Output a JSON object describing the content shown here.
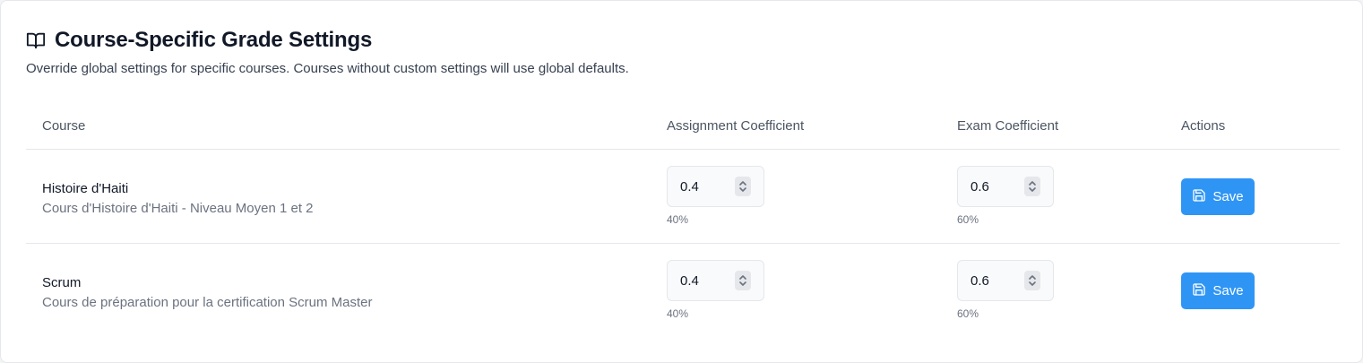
{
  "header": {
    "title": "Course-Specific Grade Settings",
    "subtitle": "Override global settings for specific courses. Courses without custom settings will use global defaults.",
    "icon": "book-open-icon"
  },
  "table": {
    "columns": [
      "Course",
      "Assignment Coefficient",
      "Exam Coefficient",
      "Actions"
    ],
    "rows": [
      {
        "name": "Histoire d'Haiti",
        "description": "Cours d'Histoire d'Haiti - Niveau Moyen 1 et 2",
        "assignment": {
          "value": "0.4",
          "percent": "40%"
        },
        "exam": {
          "value": "0.6",
          "percent": "60%"
        },
        "action_label": "Save"
      },
      {
        "name": "Scrum",
        "description": "Cours de préparation pour la certification Scrum Master",
        "assignment": {
          "value": "0.4",
          "percent": "40%"
        },
        "exam": {
          "value": "0.6",
          "percent": "60%"
        },
        "action_label": "Save"
      }
    ]
  },
  "colors": {
    "accent": "#2f95f5",
    "border": "#e5e7eb",
    "muted_text": "#6b7280"
  }
}
